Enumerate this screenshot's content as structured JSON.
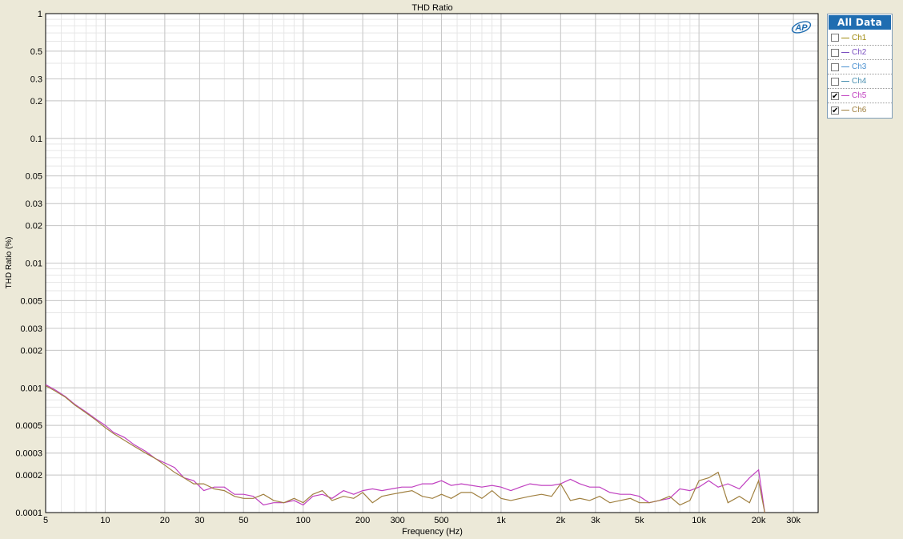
{
  "colors": {
    "background": "#ece9d8",
    "plot_bg": "#ffffff",
    "grid_major": "#c8c8c8",
    "grid_minor": "#e6e6e6",
    "legend_header_bg": "#1f6db1",
    "logo": "#1f6db1"
  },
  "logo": {
    "text": "AP",
    "icon": "ap-logo-icon"
  },
  "legend": {
    "header": "All Data",
    "items": [
      {
        "label": "Ch1",
        "checked": false,
        "color": "#a08a10"
      },
      {
        "label": "Ch2",
        "checked": false,
        "color": "#7a4fc0"
      },
      {
        "label": "Ch3",
        "checked": false,
        "color": "#4a90d0"
      },
      {
        "label": "Ch4",
        "checked": false,
        "color": "#4a90b0"
      },
      {
        "label": "Ch5",
        "checked": true,
        "color": "#c040c0"
      },
      {
        "label": "Ch6",
        "checked": true,
        "color": "#a08040"
      }
    ]
  },
  "chart_data": {
    "type": "line",
    "title": "THD Ratio",
    "xlabel": "Frequency (Hz)",
    "ylabel": "THD Ratio (%)",
    "x_scale": "log",
    "y_scale": "log",
    "xlim": [
      5,
      40000
    ],
    "ylim": [
      0.0001,
      1
    ],
    "grid": true,
    "legend_position": "right",
    "x_ticks": [
      {
        "v": 5,
        "label": "5"
      },
      {
        "v": 10,
        "label": "10"
      },
      {
        "v": 20,
        "label": "20"
      },
      {
        "v": 30,
        "label": "30"
      },
      {
        "v": 50,
        "label": "50"
      },
      {
        "v": 100,
        "label": "100"
      },
      {
        "v": 200,
        "label": "200"
      },
      {
        "v": 300,
        "label": "300"
      },
      {
        "v": 500,
        "label": "500"
      },
      {
        "v": 1000,
        "label": "1k"
      },
      {
        "v": 2000,
        "label": "2k"
      },
      {
        "v": 3000,
        "label": "3k"
      },
      {
        "v": 5000,
        "label": "5k"
      },
      {
        "v": 10000,
        "label": "10k"
      },
      {
        "v": 20000,
        "label": "20k"
      },
      {
        "v": 30000,
        "label": "30k"
      }
    ],
    "y_ticks": [
      {
        "v": 1,
        "label": "1"
      },
      {
        "v": 0.5,
        "label": "0.5"
      },
      {
        "v": 0.3,
        "label": "0.3"
      },
      {
        "v": 0.2,
        "label": "0.2"
      },
      {
        "v": 0.1,
        "label": "0.1"
      },
      {
        "v": 0.05,
        "label": "0.05"
      },
      {
        "v": 0.03,
        "label": "0.03"
      },
      {
        "v": 0.02,
        "label": "0.02"
      },
      {
        "v": 0.01,
        "label": "0.01"
      },
      {
        "v": 0.005,
        "label": "0.005"
      },
      {
        "v": 0.003,
        "label": "0.003"
      },
      {
        "v": 0.002,
        "label": "0.002"
      },
      {
        "v": 0.001,
        "label": "0.001"
      },
      {
        "v": 0.0005,
        "label": "0.0005"
      },
      {
        "v": 0.0003,
        "label": "0.0003"
      },
      {
        "v": 0.0002,
        "label": "0.0002"
      },
      {
        "v": 0.0001,
        "label": "0.0001"
      }
    ],
    "series": [
      {
        "name": "Ch5",
        "color": "#c040c0",
        "x": [
          5,
          5.6,
          6.3,
          7,
          8,
          9,
          10,
          11,
          12.5,
          14,
          16,
          18,
          20,
          22.4,
          25,
          28,
          31.5,
          35.5,
          40,
          45,
          50,
          56,
          63,
          71,
          80,
          90,
          100,
          112,
          125,
          140,
          160,
          180,
          200,
          224,
          250,
          280,
          315,
          355,
          400,
          450,
          500,
          560,
          630,
          710,
          800,
          900,
          1000,
          1120,
          1250,
          1400,
          1600,
          1800,
          2000,
          2240,
          2500,
          2800,
          3150,
          3550,
          4000,
          4500,
          5000,
          5600,
          6300,
          7100,
          8000,
          9000,
          10000,
          11200,
          12500,
          14000,
          16000,
          18000,
          20000,
          21500
        ],
        "y": [
          0.00106,
          0.00096,
          0.00085,
          0.00074,
          0.00064,
          0.00056,
          0.0005,
          0.00044,
          0.0004,
          0.00035,
          0.00031,
          0.00027,
          0.00025,
          0.00023,
          0.00019,
          0.00018,
          0.00015,
          0.00016,
          0.00016,
          0.00014,
          0.00014,
          0.000135,
          0.000115,
          0.00012,
          0.00012,
          0.000125,
          0.000115,
          0.000135,
          0.00014,
          0.00013,
          0.00015,
          0.00014,
          0.00015,
          0.000155,
          0.00015,
          0.000155,
          0.00016,
          0.00016,
          0.00017,
          0.00017,
          0.00018,
          0.000165,
          0.00017,
          0.000165,
          0.00016,
          0.000165,
          0.00016,
          0.00015,
          0.00016,
          0.00017,
          0.000165,
          0.000165,
          0.00017,
          0.000185,
          0.00017,
          0.00016,
          0.00016,
          0.000145,
          0.00014,
          0.00014,
          0.000135,
          0.00012,
          0.000125,
          0.00013,
          0.000155,
          0.00015,
          0.00016,
          0.00018,
          0.00016,
          0.00017,
          0.000155,
          0.00019,
          0.00022,
          0.0001
        ]
      },
      {
        "name": "Ch6",
        "color": "#a08040",
        "x": [
          5,
          5.6,
          6.3,
          7,
          8,
          9,
          10,
          11,
          12.5,
          14,
          16,
          18,
          20,
          22.4,
          25,
          28,
          31.5,
          35.5,
          40,
          45,
          50,
          56,
          63,
          71,
          80,
          90,
          100,
          112,
          125,
          140,
          160,
          180,
          200,
          224,
          250,
          280,
          315,
          355,
          400,
          450,
          500,
          560,
          630,
          710,
          800,
          900,
          1000,
          1120,
          1250,
          1400,
          1600,
          1800,
          2000,
          2240,
          2500,
          2800,
          3150,
          3550,
          4000,
          4500,
          5000,
          5600,
          6300,
          7100,
          8000,
          9000,
          10000,
          11200,
          12500,
          14000,
          16000,
          18000,
          20000,
          21500
        ],
        "y": [
          0.00104,
          0.00094,
          0.00084,
          0.00073,
          0.00063,
          0.00055,
          0.00048,
          0.00043,
          0.00038,
          0.00034,
          0.0003,
          0.00027,
          0.00024,
          0.00021,
          0.00019,
          0.00017,
          0.00017,
          0.000155,
          0.00015,
          0.000135,
          0.00013,
          0.00013,
          0.00014,
          0.000125,
          0.00012,
          0.00013,
          0.00012,
          0.00014,
          0.00015,
          0.000125,
          0.000135,
          0.00013,
          0.000145,
          0.00012,
          0.000135,
          0.00014,
          0.000145,
          0.00015,
          0.000135,
          0.00013,
          0.00014,
          0.00013,
          0.000145,
          0.000145,
          0.00013,
          0.00015,
          0.00013,
          0.000125,
          0.00013,
          0.000135,
          0.00014,
          0.000135,
          0.00017,
          0.000125,
          0.00013,
          0.000125,
          0.000135,
          0.00012,
          0.000125,
          0.00013,
          0.00012,
          0.00012,
          0.000125,
          0.000135,
          0.000115,
          0.000125,
          0.00018,
          0.00019,
          0.00021,
          0.00012,
          0.000135,
          0.00012,
          0.00018,
          0.0001
        ]
      }
    ]
  }
}
